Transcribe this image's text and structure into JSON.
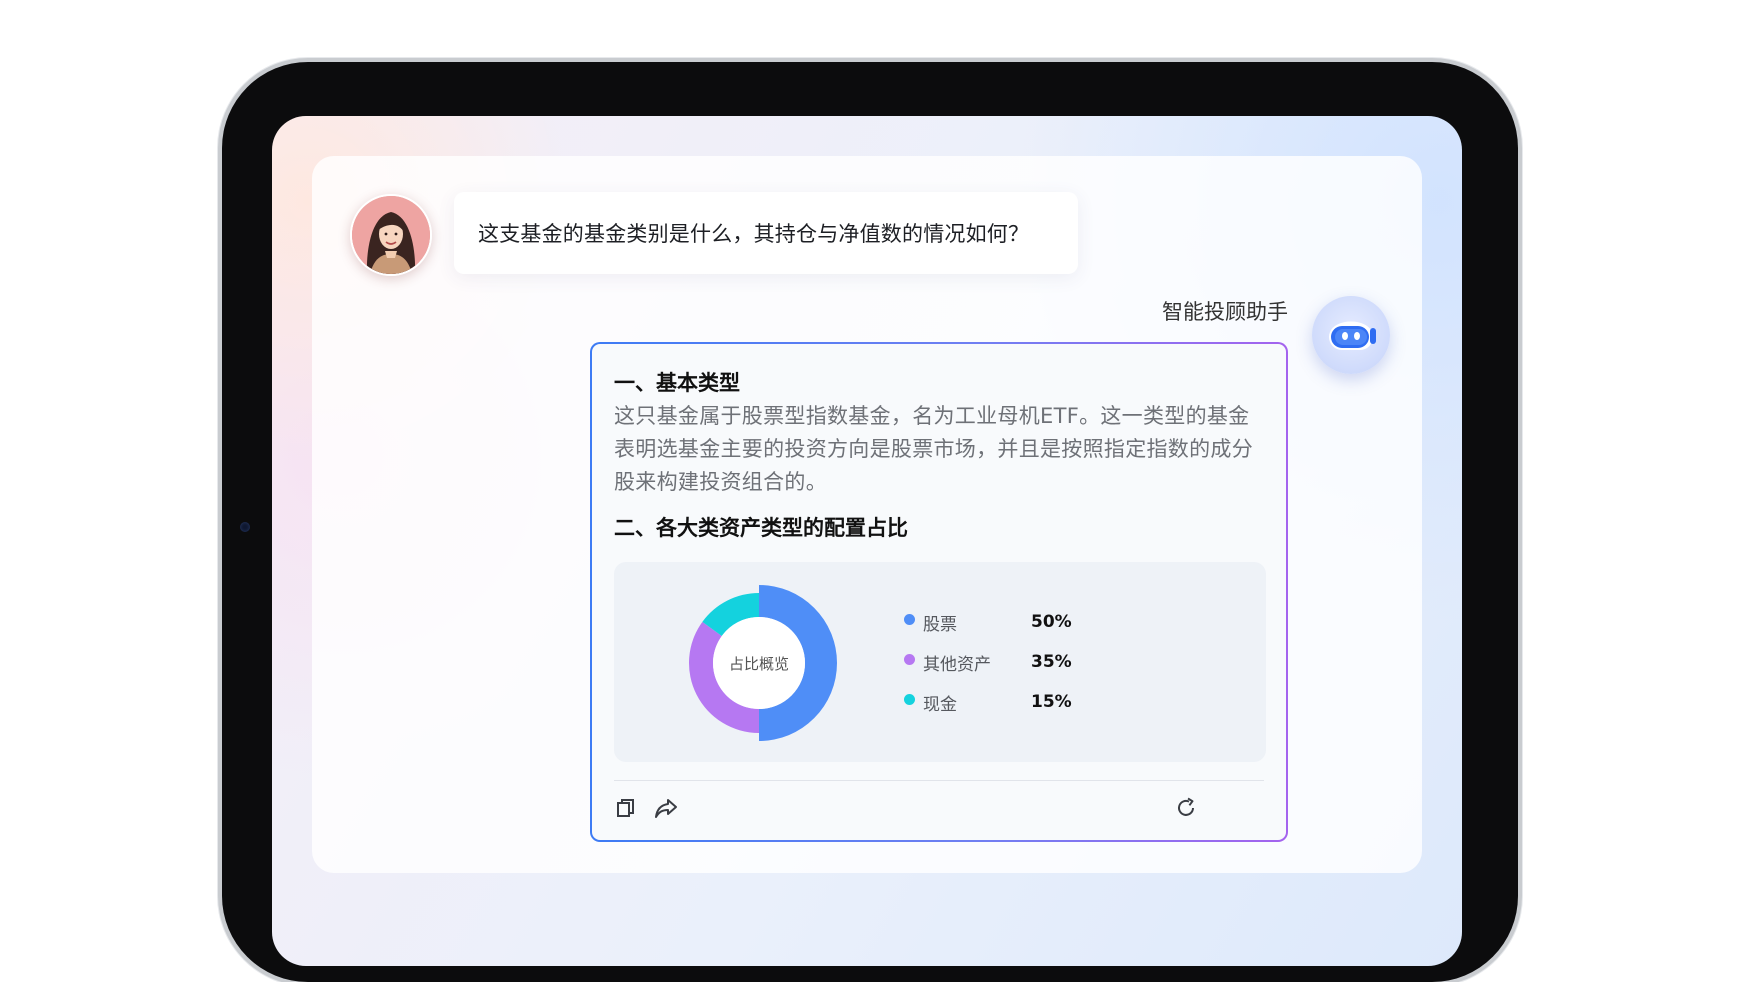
{
  "chat": {
    "user_message": "这支基金的基金类别是什么，其持仓与净值数的情况如何？",
    "assistant_name": "智能投顾助手"
  },
  "answer": {
    "section1_title": "一、基本类型",
    "section1_body": "这只基金属于股票型指数基金，名为工业母机ETF。这一类型的基金表明选基金主要的投资方向是股票市场，并且是按照指定指数的成分股来构建投资组合的。",
    "section2_title": "二、各大类资产类型的配置占比"
  },
  "chart_data": {
    "type": "pie",
    "center_label": "占比概览",
    "slices": [
      {
        "label": "股票",
        "value": 50,
        "display": "50%",
        "color": "#4f8ef7"
      },
      {
        "label": "其他资产",
        "value": 35,
        "display": "35%",
        "color": "#b678f2"
      },
      {
        "label": "现金",
        "value": 15,
        "display": "15%",
        "color": "#14d2de"
      }
    ]
  },
  "toolbar": {
    "copy_icon": "copy-icon",
    "share_icon": "share-icon",
    "refresh_icon": "refresh-icon"
  }
}
